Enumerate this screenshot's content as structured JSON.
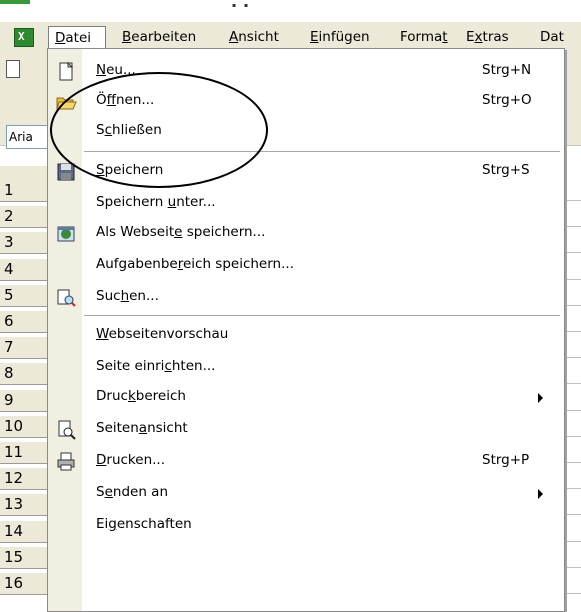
{
  "menubar": {
    "items": [
      {
        "label": "Datei",
        "underline_index": 0
      },
      {
        "label": "Bearbeiten",
        "underline_index": 0
      },
      {
        "label": "Ansicht",
        "underline_index": 0
      },
      {
        "label": "Einfügen",
        "underline_index": 0
      },
      {
        "label": "Format",
        "underline_index": 5
      },
      {
        "label": "Extras",
        "underline_index": 1
      },
      {
        "label": "Dat",
        "underline_index": -1
      }
    ]
  },
  "toolbar": {
    "font_name": "Aria"
  },
  "row_numbers": [
    "1",
    "2",
    "3",
    "4",
    "5",
    "6",
    "7",
    "8",
    "9",
    "10",
    "11",
    "12",
    "13",
    "14",
    "15",
    "16"
  ],
  "file_menu": {
    "items": [
      {
        "pre": "",
        "u": "N",
        "post": "eu...",
        "shortcut": "Strg+N",
        "icon": "new-document-icon",
        "arrow": false
      },
      {
        "pre": "Ö",
        "u": "f",
        "post": "fnen...",
        "shortcut": "Strg+O",
        "icon": "open-folder-icon",
        "arrow": false
      },
      {
        "pre": "S",
        "u": "c",
        "post": "hließen",
        "shortcut": "",
        "icon": "",
        "arrow": false
      },
      {
        "pre": "",
        "u": "S",
        "post": "peichern",
        "shortcut": "Strg+S",
        "icon": "save-disk-icon",
        "arrow": false
      },
      {
        "pre": "Speichern ",
        "u": "u",
        "post": "nter...",
        "shortcut": "",
        "icon": "",
        "arrow": false
      },
      {
        "pre": "Als Webseit",
        "u": "e",
        "post": " speichern...",
        "shortcut": "",
        "icon": "web-save-icon",
        "arrow": false
      },
      {
        "pre": "Aufgabenbe",
        "u": "r",
        "post": "eich speichern...",
        "shortcut": "",
        "icon": "",
        "arrow": false
      },
      {
        "pre": "Suc",
        "u": "h",
        "post": "en...",
        "shortcut": "",
        "icon": "search-file-icon",
        "arrow": false
      },
      {
        "pre": "",
        "u": "W",
        "post": "ebseitenvorschau",
        "shortcut": "",
        "icon": "",
        "arrow": false
      },
      {
        "pre": "Seite einri",
        "u": "c",
        "post": "hten...",
        "shortcut": "",
        "icon": "",
        "arrow": false
      },
      {
        "pre": "Druc",
        "u": "k",
        "post": "bereich",
        "shortcut": "",
        "icon": "",
        "arrow": true
      },
      {
        "pre": "Seiten",
        "u": "a",
        "post": "nsicht",
        "shortcut": "",
        "icon": "print-preview-icon",
        "arrow": false
      },
      {
        "pre": "",
        "u": "D",
        "post": "rucken...",
        "shortcut": "Strg+P",
        "icon": "printer-icon",
        "arrow": false
      },
      {
        "pre": "S",
        "u": "e",
        "post": "nden an",
        "shortcut": "",
        "icon": "",
        "arrow": true
      },
      {
        "pre": "Ei",
        "u": "g",
        "post": "enschaften",
        "shortcut": "",
        "icon": "",
        "arrow": false
      }
    ]
  }
}
